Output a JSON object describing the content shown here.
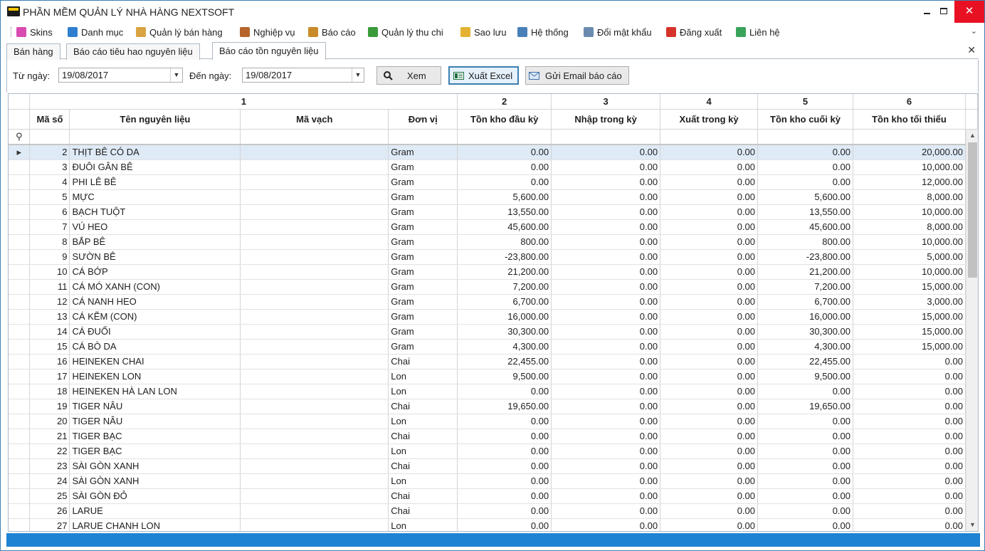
{
  "app": {
    "title": "PHẦN MỀM QUẢN LÝ NHÀ HÀNG NEXTSOFT"
  },
  "window_controls": {
    "minimize": "minimize",
    "maximize": "maximize",
    "close": "✕"
  },
  "menu": [
    {
      "label": "Skins",
      "icon": "palette-icon",
      "color": "#d94bb0"
    },
    {
      "label": "Danh mục",
      "icon": "grid-icon",
      "color": "#2f7fd0"
    },
    {
      "label": "Quản lý bán hàng",
      "icon": "tag-icon",
      "color": "#d9a441"
    },
    {
      "label": "Nghiệp vụ",
      "icon": "briefcase-icon",
      "color": "#b5652b"
    },
    {
      "label": "Báo cáo",
      "icon": "clipboard-icon",
      "color": "#c98b2a"
    },
    {
      "label": "Quản lý thu chi",
      "icon": "money-icon",
      "color": "#3a9b3a"
    },
    {
      "label": "Sao lưu",
      "icon": "database-icon",
      "color": "#e3b233"
    },
    {
      "label": "Hệ thống",
      "icon": "gears-icon",
      "color": "#4a7fb8"
    },
    {
      "label": "Đổi mật khẩu",
      "icon": "key-icon",
      "color": "#6a8bb0"
    },
    {
      "label": "Đăng xuất",
      "icon": "logout-icon",
      "color": "#d6332b"
    },
    {
      "label": "Liên hệ",
      "icon": "user-icon",
      "color": "#3aa35a"
    }
  ],
  "tabs": [
    {
      "label": "Bán hàng",
      "active": false
    },
    {
      "label": "Báo cáo tiêu hao nguyên liệu",
      "active": false
    },
    {
      "label": "Báo cáo tồn nguyên liệu",
      "active": true
    }
  ],
  "filter": {
    "from_label": "Từ ngày:",
    "from_value": "19/08/2017",
    "to_label": "Đến ngày:",
    "to_value": "19/08/2017",
    "view_button": "Xem",
    "excel_button": "Xuất Excel",
    "email_button": "Gửi Email báo cáo"
  },
  "grid": {
    "bands": [
      "1",
      "2",
      "3",
      "4",
      "5",
      "6"
    ],
    "columns": [
      "Mã số",
      "Tên nguyên liệu",
      "Mã vạch",
      "Đơn vị",
      "Tồn kho đầu kỳ",
      "Nhập trong kỳ",
      "Xuất trong kỳ",
      "Tồn kho cuối kỳ",
      "Tồn kho tối thiểu"
    ],
    "rows": [
      [
        "2",
        "THỊT BÊ CÓ DA",
        "",
        "Gram",
        "0.00",
        "0.00",
        "0.00",
        "0.00",
        "20,000.00"
      ],
      [
        "3",
        "ĐUÔI GÂN BÊ",
        "",
        "Gram",
        "0.00",
        "0.00",
        "0.00",
        "0.00",
        "10,000.00"
      ],
      [
        "4",
        "PHI LÊ BÊ",
        "",
        "Gram",
        "0.00",
        "0.00",
        "0.00",
        "0.00",
        "12,000.00"
      ],
      [
        "5",
        "MỰC",
        "",
        "Gram",
        "5,600.00",
        "0.00",
        "0.00",
        "5,600.00",
        "8,000.00"
      ],
      [
        "6",
        "BẠCH TUỘT",
        "",
        "Gram",
        "13,550.00",
        "0.00",
        "0.00",
        "13,550.00",
        "10,000.00"
      ],
      [
        "7",
        "VÚ HEO",
        "",
        "Gram",
        "45,600.00",
        "0.00",
        "0.00",
        "45,600.00",
        "8,000.00"
      ],
      [
        "8",
        "BẮP BÊ",
        "",
        "Gram",
        "800.00",
        "0.00",
        "0.00",
        "800.00",
        "10,000.00"
      ],
      [
        "9",
        "SƯỜN BÊ",
        "",
        "Gram",
        "-23,800.00",
        "0.00",
        "0.00",
        "-23,800.00",
        "5,000.00"
      ],
      [
        "10",
        "CÁ BỚP",
        "",
        "Gram",
        "21,200.00",
        "0.00",
        "0.00",
        "21,200.00",
        "10,000.00"
      ],
      [
        "11",
        "CÁ MÓ XANH (CON)",
        "",
        "Gram",
        "7,200.00",
        "0.00",
        "0.00",
        "7,200.00",
        "15,000.00"
      ],
      [
        "12",
        "CÁ NANH HEO",
        "",
        "Gram",
        "6,700.00",
        "0.00",
        "0.00",
        "6,700.00",
        "3,000.00"
      ],
      [
        "13",
        "CÁ KẼM (CON)",
        "",
        "Gram",
        "16,000.00",
        "0.00",
        "0.00",
        "16,000.00",
        "15,000.00"
      ],
      [
        "14",
        "CÁ ĐUỐI",
        "",
        "Gram",
        "30,300.00",
        "0.00",
        "0.00",
        "30,300.00",
        "15,000.00"
      ],
      [
        "15",
        "CÁ BÒ DA",
        "",
        "Gram",
        "4,300.00",
        "0.00",
        "0.00",
        "4,300.00",
        "15,000.00"
      ],
      [
        "16",
        "HEINEKEN CHAI",
        "",
        "Chai",
        "22,455.00",
        "0.00",
        "0.00",
        "22,455.00",
        "0.00"
      ],
      [
        "17",
        "HEINEKEN LON",
        "",
        "Lon",
        "9,500.00",
        "0.00",
        "0.00",
        "9,500.00",
        "0.00"
      ],
      [
        "18",
        "HEINEKEN HÀ LAN LON",
        "",
        "Lon",
        "0.00",
        "0.00",
        "0.00",
        "0.00",
        "0.00"
      ],
      [
        "19",
        "TIGER NÂU",
        "",
        "Chai",
        "19,650.00",
        "0.00",
        "0.00",
        "19,650.00",
        "0.00"
      ],
      [
        "20",
        "TIGER NÂU",
        "",
        "Lon",
        "0.00",
        "0.00",
        "0.00",
        "0.00",
        "0.00"
      ],
      [
        "21",
        "TIGER BẠC",
        "",
        "Chai",
        "0.00",
        "0.00",
        "0.00",
        "0.00",
        "0.00"
      ],
      [
        "22",
        "TIGER BẠC",
        "",
        "Lon",
        "0.00",
        "0.00",
        "0.00",
        "0.00",
        "0.00"
      ],
      [
        "23",
        "SÀI GÒN XANH",
        "",
        "Chai",
        "0.00",
        "0.00",
        "0.00",
        "0.00",
        "0.00"
      ],
      [
        "24",
        "SÀI GÒN XANH",
        "",
        "Lon",
        "0.00",
        "0.00",
        "0.00",
        "0.00",
        "0.00"
      ],
      [
        "25",
        "SÀI GÒN ĐỎ",
        "",
        "Chai",
        "0.00",
        "0.00",
        "0.00",
        "0.00",
        "0.00"
      ],
      [
        "26",
        "LARUE",
        "",
        "Chai",
        "0.00",
        "0.00",
        "0.00",
        "0.00",
        "0.00"
      ],
      [
        "27",
        "LARUE CHANH LON",
        "",
        "Lon",
        "0.00",
        "0.00",
        "0.00",
        "0.00",
        "0.00"
      ]
    ],
    "selected_row": 0,
    "filter_row_icon": "⚲",
    "row_indicator": "▸"
  },
  "colors": {
    "accent": "#1e83d2",
    "selection": "#dfeaf7",
    "close": "#e81123"
  }
}
